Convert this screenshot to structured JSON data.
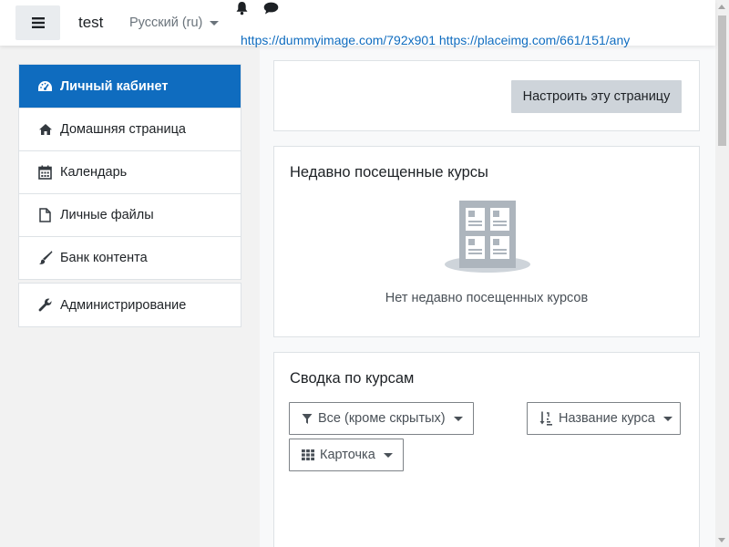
{
  "header": {
    "site_name": "test",
    "language": "Русский (ru)",
    "url_links": "https://dummyimage.com/792x901 https://placeimg.com/661/151/any"
  },
  "nav": {
    "items": [
      {
        "label": "Личный кабинет",
        "icon": "dashboard-icon",
        "active": true
      },
      {
        "label": "Домашняя страница",
        "icon": "home-icon"
      },
      {
        "label": "Календарь",
        "icon": "calendar-icon"
      },
      {
        "label": "Личные файлы",
        "icon": "file-icon"
      },
      {
        "label": "Банк контента",
        "icon": "brush-icon"
      }
    ],
    "admin": {
      "label": "Администрирование",
      "icon": "wrench-icon"
    }
  },
  "main": {
    "customize_button": "Настроить эту страницу",
    "recent": {
      "title": "Недавно посещенные курсы",
      "empty_text": "Нет недавно посещенных курсов"
    },
    "overview": {
      "title": "Сводка по курсам",
      "filter_label": "Все (кроме скрытых)",
      "sort_label": "Название курса",
      "view_label": "Карточка"
    }
  },
  "colors": {
    "primary": "#0f6cbf",
    "secondary_button": "#ced4da",
    "border": "#dee2e6",
    "background": "#f2f2f2"
  }
}
